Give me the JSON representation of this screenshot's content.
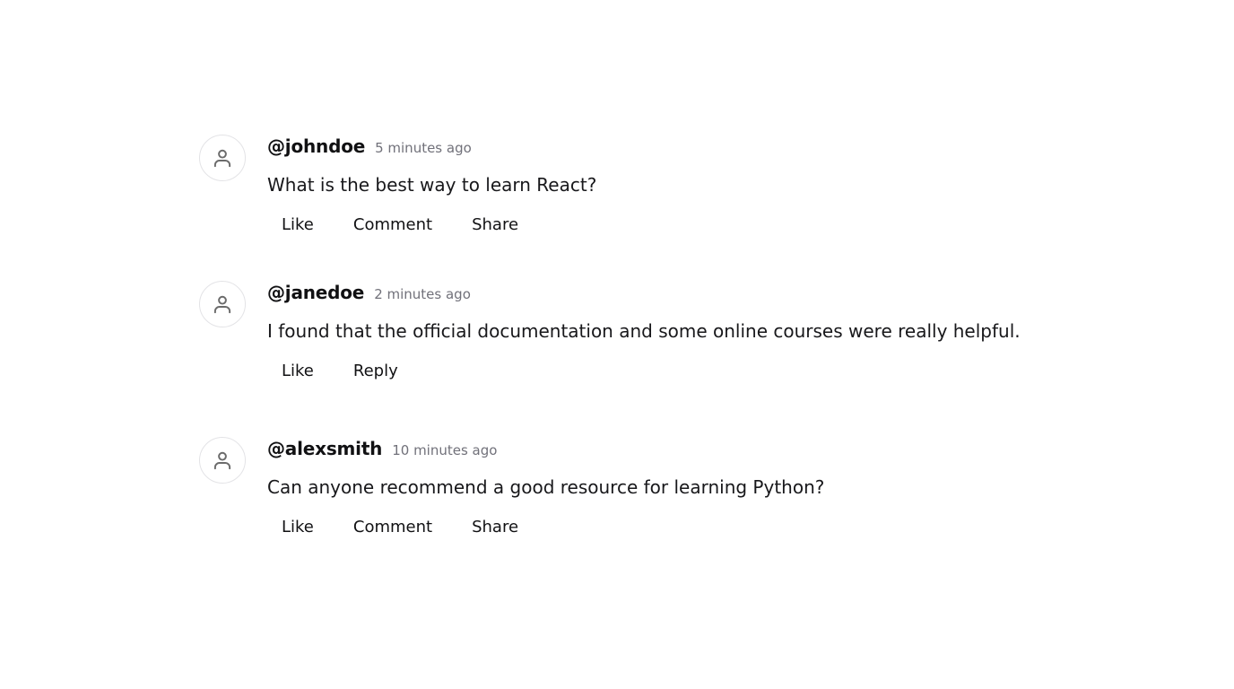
{
  "comments": [
    {
      "avatar_icon": "user-icon",
      "username": "@johndoe",
      "time": "5 minutes ago",
      "text": "What is the best way to learn React?",
      "actions": [
        "Like",
        "Comment",
        "Share"
      ]
    },
    {
      "avatar_icon": "user-icon",
      "username": "@janedoe",
      "time": "2 minutes ago",
      "text": "I found that the official documentation and some online courses were really helpful.",
      "actions": [
        "Like",
        "Reply"
      ]
    },
    {
      "avatar_icon": "user-icon",
      "username": "@alexsmith",
      "time": "10 minutes ago",
      "text": "Can anyone recommend a good resource for learning Python?",
      "actions": [
        "Like",
        "Comment",
        "Share"
      ]
    }
  ],
  "colors": {
    "text": "#111113",
    "muted": "#71717a",
    "avatar_border": "#e3e3e6",
    "icon": "#6b6b6b"
  }
}
